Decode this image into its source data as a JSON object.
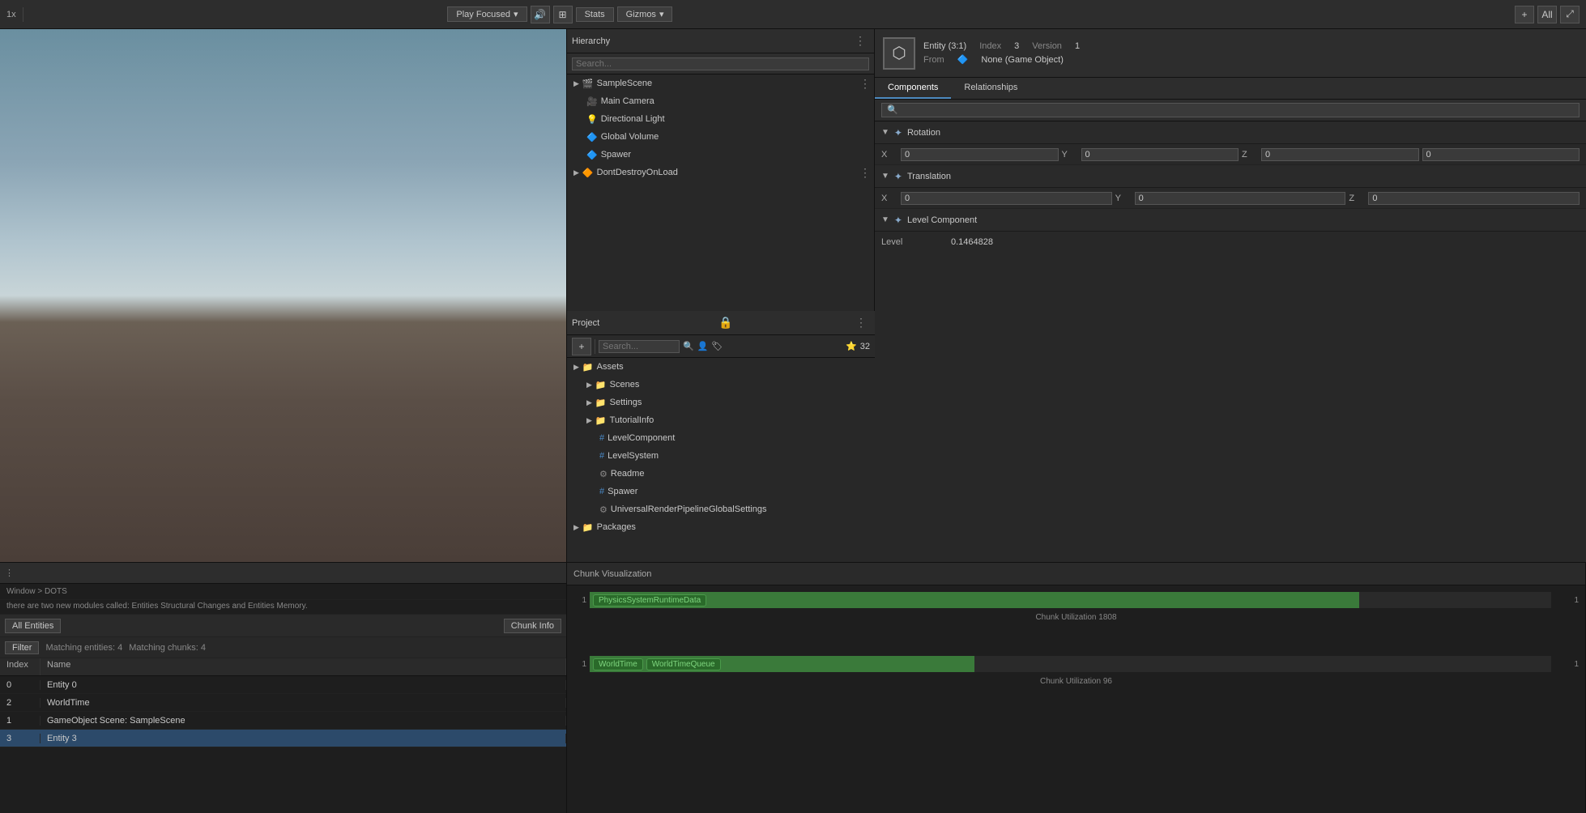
{
  "topbar": {
    "multiplier": "1x",
    "play_focused": "Play Focused",
    "stats": "Stats",
    "gizmos": "Gizmos",
    "add_icon": "+",
    "all_label": "All"
  },
  "hierarchy": {
    "title": "Hierarchy",
    "search_placeholder": "Search...",
    "sample_scene": "SampleScene",
    "items": [
      {
        "label": "Main Camera",
        "indent": 1
      },
      {
        "label": "Directional Light",
        "indent": 1
      },
      {
        "label": "Global Volume",
        "indent": 1
      },
      {
        "label": "Spawer",
        "indent": 1
      },
      {
        "label": "DontDestroyOnLoad",
        "indent": 0
      }
    ]
  },
  "inspector": {
    "entity_label": "Entity (3:1)",
    "index_label": "Index",
    "index_value": "3",
    "version_label": "Version",
    "version_value": "1",
    "from_label": "From",
    "from_value": "None (Game Object)",
    "tabs": [
      "Components",
      "Relationships"
    ],
    "active_tab": "Components",
    "search_placeholder": "🔍",
    "rotation": {
      "header": "Rotation",
      "x_label": "X",
      "x_value": "0",
      "y_label": "Y",
      "y_value": "0",
      "z_label": "Z",
      "z_value": "0",
      "w_value": "0"
    },
    "translation": {
      "header": "Translation",
      "x_label": "X",
      "x_value": "0",
      "y_label": "Y",
      "y_value": "0",
      "z_label": "Z",
      "z_value": "0"
    },
    "level_component": {
      "header": "Level Component",
      "level_label": "Level",
      "level_value": "0.1464828"
    }
  },
  "entities": {
    "all_entities": "All Entities",
    "chunk_info": "Chunk Info",
    "filter": "Filter",
    "matching_entities": "Matching entities: 4",
    "matching_chunks": "Matching chunks: 4",
    "col_index": "Index",
    "col_name": "Name",
    "rows": [
      {
        "index": "0",
        "name": "Entity 0",
        "selected": false
      },
      {
        "index": "2",
        "name": "WorldTime",
        "selected": false
      },
      {
        "index": "1",
        "name": "GameObject Scene: SampleScene",
        "selected": false
      },
      {
        "index": "3",
        "name": "Entity 3",
        "selected": true
      }
    ]
  },
  "breadcrumb": {
    "window": "Window",
    "dots": "DOTS"
  },
  "message": "there are two new modules called: Entities Structural Changes and Entities Memory.",
  "chunk_bars": {
    "bar1": {
      "num_start": "1",
      "tag": "PhysicsSystemRuntimeData",
      "num_end": "1",
      "utilization_label": "Chunk Utilization",
      "utilization_val": "1808"
    },
    "bar2": {
      "num_start": "1",
      "tag1": "WorldTime",
      "tag2": "WorldTimeQueue",
      "num_end": "1",
      "utilization_label": "Chunk Utilization",
      "utilization_val": "96"
    }
  },
  "project": {
    "title": "Project",
    "add_icon": "+",
    "search_placeholder": "Search...",
    "star_count": "32",
    "assets_label": "Assets",
    "items": [
      {
        "label": "Scenes",
        "type": "folder",
        "indent": 1
      },
      {
        "label": "Settings",
        "type": "folder",
        "indent": 1
      },
      {
        "label": "TutorialInfo",
        "type": "folder",
        "indent": 1
      },
      {
        "label": "LevelComponent",
        "type": "script",
        "indent": 2
      },
      {
        "label": "LevelSystem",
        "type": "script",
        "indent": 2
      },
      {
        "label": "Readme",
        "type": "asset",
        "indent": 2
      },
      {
        "label": "Spawer",
        "type": "script",
        "indent": 2
      },
      {
        "label": "UniversalRenderPipelineGlobalSettings",
        "type": "asset",
        "indent": 2
      },
      {
        "label": "Packages",
        "type": "folder",
        "indent": 0
      }
    ]
  }
}
